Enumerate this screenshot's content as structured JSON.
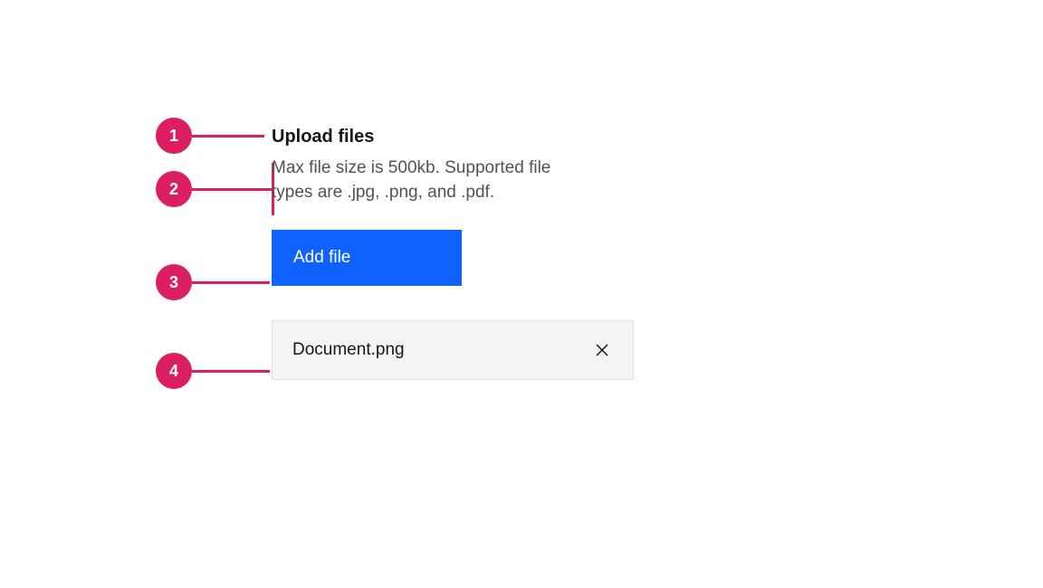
{
  "callouts": {
    "c1": "1",
    "c2": "2",
    "c3": "3",
    "c4": "4"
  },
  "uploader": {
    "title": "Upload files",
    "description": "Max file size is 500kb. Supported file types are .jpg, .png, and .pdf.",
    "add_button_label": "Add file",
    "file": {
      "name": "Document.png"
    }
  },
  "colors": {
    "callout_accent": "#da1e5f",
    "primary_button": "#0f62fe",
    "file_row_bg": "#f4f4f4"
  }
}
